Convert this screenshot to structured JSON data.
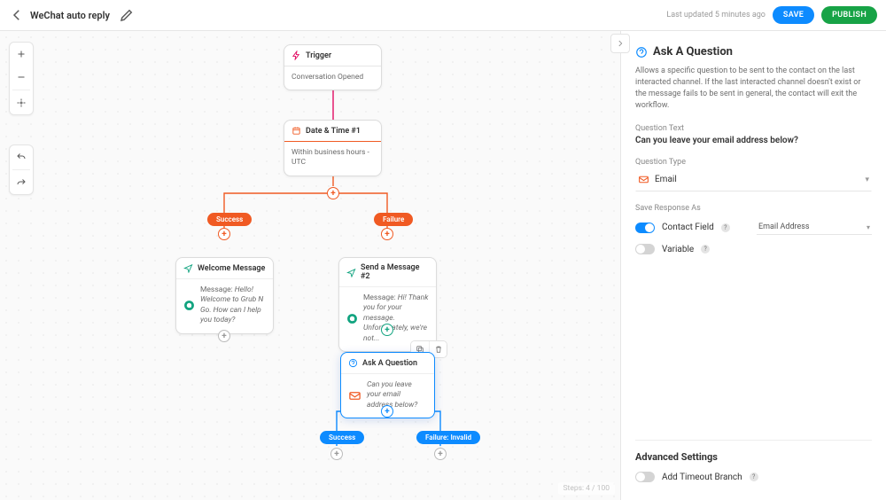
{
  "header": {
    "title": "WeChat auto reply",
    "last_updated": "Last updated 5 minutes ago",
    "save_label": "SAVE",
    "publish_label": "PUBLISH"
  },
  "canvas": {
    "steps_counter": "Steps: 4 / 100",
    "pills": {
      "success1": "Success",
      "failure1": "Failure",
      "success2": "Success",
      "failure2": "Failure: Invalid"
    },
    "nodes": {
      "trigger": {
        "title": "Trigger",
        "body": "Conversation Opened"
      },
      "datetime": {
        "title": "Date & Time #1",
        "body": "Within business hours - UTC"
      },
      "welcome": {
        "title": "Welcome Message",
        "prefix": "Message:",
        "body": "Hello! Welcome to Grub N Go. How can I help you today?"
      },
      "send2": {
        "title": "Send a Message #2",
        "prefix": "Message:",
        "body": "Hi! Thank you for your message. Unfortunately, we're not..."
      },
      "ask": {
        "title": "Ask A Question",
        "body": "Can you leave your email address below?"
      }
    }
  },
  "panel": {
    "title": "Ask A Question",
    "description": "Allows a specific question to be sent to the contact on the last interacted channel. If the last interacted channel doesn't exist or the message fails to be sent in general, the contact will exit the workflow.",
    "question_text_label": "Question Text",
    "question_text_value": "Can you leave your email address below?",
    "question_type_label": "Question Type",
    "question_type_value": "Email",
    "save_response_label": "Save Response As",
    "contact_field_label": "Contact Field",
    "contact_field_select": "Email Address",
    "variable_label": "Variable",
    "advanced_label": "Advanced Settings",
    "timeout_label": "Add Timeout Branch"
  }
}
